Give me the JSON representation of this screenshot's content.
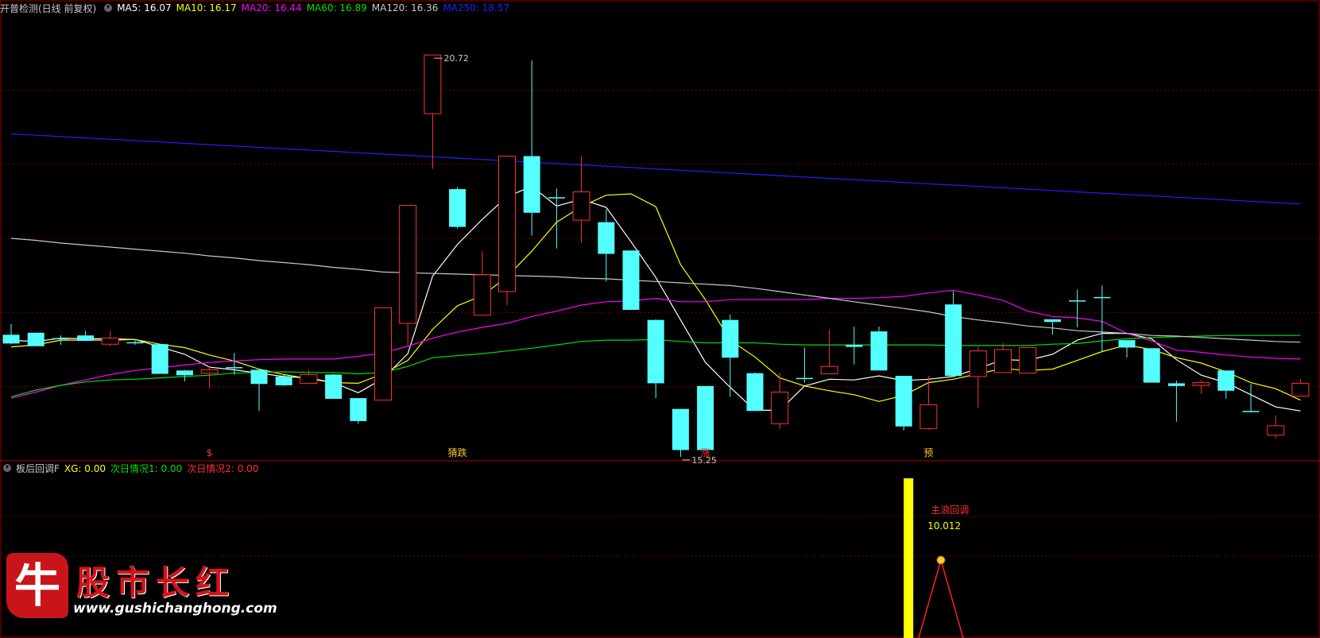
{
  "main_panel": {
    "title": "开普检测(日线 前复权)",
    "ma_labels": [
      {
        "name": "MA5",
        "value": "16.07",
        "color": "#ffffff"
      },
      {
        "name": "MA10",
        "value": "16.17",
        "color": "#ffff00"
      },
      {
        "name": "MA20",
        "value": "16.44",
        "color": "#ff00ff"
      },
      {
        "name": "MA60",
        "value": "16.89",
        "color": "#00e000"
      },
      {
        "name": "MA120",
        "value": "16.36",
        "color": "#c8c8c8"
      },
      {
        "name": "MA250",
        "value": "18.57",
        "color": "#2020ff"
      }
    ]
  },
  "sub_panel": {
    "title": "板后回调F",
    "indicators": [
      {
        "name": "XG",
        "value": "0.00",
        "color": "#ffff00"
      },
      {
        "name": "次日情况1",
        "value": "0.00",
        "color": "#00e000"
      },
      {
        "name": "次日情况2",
        "value": "0.00",
        "color": "#ff3030"
      }
    ]
  },
  "chart_data": [
    {
      "type": "candlestick",
      "ylim": [
        14.7,
        21.3
      ],
      "colors": {
        "up": "#ff3232",
        "down": "#54ffff",
        "bg": "#000000"
      },
      "candles": [
        [
          16.57,
          16.44,
          16.73,
          16.43
        ],
        [
          16.6,
          16.4,
          16.6,
          16.4
        ],
        [
          16.52,
          16.52,
          16.56,
          16.42
        ],
        [
          16.56,
          16.48,
          16.63,
          16.48
        ],
        [
          16.43,
          16.52,
          16.63,
          16.4
        ],
        [
          16.46,
          16.46,
          16.5,
          16.42
        ],
        [
          16.43,
          15.99,
          16.43,
          15.99
        ],
        [
          16.04,
          15.97,
          16.05,
          15.88
        ],
        [
          16.0,
          16.05,
          16.1,
          15.77
        ],
        [
          16.09,
          16.09,
          16.3,
          15.98
        ],
        [
          16.05,
          15.84,
          16.05,
          15.44
        ],
        [
          15.95,
          15.82,
          15.98,
          15.81
        ],
        [
          15.85,
          15.98,
          16.05,
          15.85
        ],
        [
          15.98,
          15.62,
          15.99,
          15.62
        ],
        [
          15.63,
          15.29,
          15.63,
          15.25
        ],
        [
          15.6,
          16.97,
          16.97,
          15.6
        ],
        [
          16.74,
          18.49,
          18.49,
          16.41
        ],
        [
          19.85,
          20.72,
          20.72,
          19.03
        ],
        [
          18.73,
          18.17,
          18.76,
          18.15
        ],
        [
          16.86,
          17.46,
          17.81,
          16.86
        ],
        [
          17.21,
          19.22,
          19.22,
          17.01
        ],
        [
          19.22,
          18.38,
          20.64,
          18.04
        ],
        [
          18.61,
          18.61,
          18.74,
          17.85
        ],
        [
          18.27,
          18.69,
          19.22,
          17.93
        ],
        [
          18.24,
          17.77,
          18.43,
          17.36
        ],
        [
          17.82,
          16.94,
          17.82,
          16.94
        ],
        [
          16.79,
          15.85,
          16.8,
          15.63
        ],
        [
          15.47,
          14.86,
          15.47,
          14.76
        ],
        [
          15.81,
          14.86,
          15.81,
          14.86
        ],
        [
          16.79,
          16.23,
          16.87,
          15.65
        ],
        [
          16.0,
          15.44,
          16.01,
          15.44
        ],
        [
          15.25,
          15.72,
          16.01,
          15.17
        ],
        [
          15.93,
          15.93,
          16.38,
          15.86
        ],
        [
          15.99,
          16.1,
          16.65,
          15.99
        ],
        [
          16.42,
          16.39,
          16.69,
          16.13
        ],
        [
          16.62,
          16.04,
          16.69,
          16.04
        ],
        [
          15.96,
          15.21,
          15.96,
          15.15
        ],
        [
          15.18,
          15.53,
          15.96,
          15.16
        ],
        [
          17.02,
          15.96,
          17.22,
          15.96
        ],
        [
          15.95,
          16.33,
          16.39,
          15.49
        ],
        [
          16.01,
          16.35,
          16.45,
          16.01
        ],
        [
          16.0,
          16.38,
          16.38,
          16.0
        ],
        [
          16.8,
          16.76,
          16.8,
          16.57
        ],
        [
          17.08,
          17.08,
          17.24,
          16.68
        ],
        [
          17.13,
          17.13,
          17.3,
          16.32
        ],
        [
          16.49,
          16.38,
          16.49,
          16.23
        ],
        [
          16.37,
          15.86,
          16.37,
          15.86
        ],
        [
          15.85,
          15.81,
          15.89,
          15.28
        ],
        [
          15.82,
          15.86,
          15.9,
          15.69
        ],
        [
          16.04,
          15.74,
          16.04,
          15.62
        ],
        [
          15.44,
          15.44,
          15.84,
          15.44
        ],
        [
          15.08,
          15.22,
          15.37,
          15.03
        ],
        [
          15.66,
          15.85,
          15.91,
          15.68
        ]
      ]
    },
    {
      "type": "line",
      "series": [
        {
          "name": "MA5",
          "color": "#ffffff",
          "values": [
            16.49,
            16.47,
            16.52,
            16.51,
            16.51,
            16.5,
            16.39,
            16.28,
            16.09,
            16.05,
            16.0,
            15.95,
            15.93,
            15.86,
            15.71,
            15.92,
            16.29,
            17.44,
            17.91,
            18.28,
            18.62,
            18.77,
            18.48,
            18.58,
            18.46,
            17.95,
            17.42,
            16.79,
            16.16,
            15.79,
            15.45,
            15.45,
            15.81,
            15.91,
            15.9,
            15.96,
            15.89,
            15.91,
            15.95,
            16.07,
            16.2,
            16.19,
            16.28,
            16.49,
            16.59,
            16.59,
            16.51,
            16.2,
            15.97,
            15.86,
            15.68,
            15.5,
            15.44
          ]
        },
        {
          "name": "MA10",
          "color": "#ffff00",
          "values": [
            16.39,
            16.42,
            16.49,
            16.49,
            16.49,
            16.5,
            16.43,
            16.38,
            16.27,
            16.18,
            16.06,
            15.98,
            15.92,
            15.86,
            15.85,
            15.99,
            16.19,
            16.65,
            17.0,
            17.15,
            17.43,
            17.81,
            18.24,
            18.47,
            18.64,
            18.66,
            18.47,
            17.61,
            17.09,
            16.49,
            16.24,
            15.93,
            15.81,
            15.74,
            15.68,
            15.58,
            15.67,
            15.86,
            15.91,
            15.99,
            16.07,
            16.04,
            16.06,
            16.19,
            16.32,
            16.42,
            16.35,
            16.23,
            16.15,
            16.02,
            15.86,
            15.77,
            15.6
          ]
        },
        {
          "name": "MA20",
          "color": "#ff00ff",
          "values": [
            15.63,
            15.72,
            15.82,
            15.9,
            15.98,
            16.04,
            16.08,
            16.12,
            16.16,
            16.18,
            16.2,
            16.21,
            16.21,
            16.21,
            16.25,
            16.3,
            16.4,
            16.52,
            16.61,
            16.68,
            16.74,
            16.84,
            16.92,
            17.01,
            17.06,
            17.07,
            17.11,
            17.06,
            17.06,
            17.09,
            17.09,
            17.09,
            17.09,
            17.11,
            17.11,
            17.12,
            17.14,
            17.19,
            17.23,
            17.16,
            17.08,
            16.92,
            16.84,
            16.82,
            16.77,
            16.59,
            16.48,
            16.34,
            16.31,
            16.27,
            16.24,
            16.22,
            16.21
          ]
        },
        {
          "name": "MA60",
          "color": "#00e000",
          "values": [
            15.65,
            15.75,
            15.82,
            15.87,
            15.9,
            15.91,
            15.93,
            15.95,
            15.97,
            16.0,
            16.01,
            16.02,
            16.01,
            16.01,
            15.99,
            16.01,
            16.1,
            16.23,
            16.26,
            16.29,
            16.33,
            16.37,
            16.42,
            16.47,
            16.49,
            16.49,
            16.5,
            16.47,
            16.45,
            16.45,
            16.45,
            16.43,
            16.42,
            16.42,
            16.42,
            16.42,
            16.42,
            16.42,
            16.41,
            16.41,
            16.41,
            16.41,
            16.43,
            16.44,
            16.48,
            16.51,
            16.53,
            16.54,
            16.55,
            16.56,
            16.56,
            16.56,
            16.56
          ]
        },
        {
          "name": "MA120",
          "color": "#c8c8c8",
          "values": [
            18.0,
            17.97,
            17.93,
            17.9,
            17.87,
            17.84,
            17.81,
            17.78,
            17.74,
            17.71,
            17.67,
            17.64,
            17.61,
            17.57,
            17.54,
            17.5,
            17.49,
            17.48,
            17.47,
            17.46,
            17.45,
            17.44,
            17.43,
            17.41,
            17.4,
            17.38,
            17.36,
            17.34,
            17.32,
            17.3,
            17.26,
            17.21,
            17.16,
            17.11,
            17.06,
            17.01,
            16.96,
            16.91,
            16.84,
            16.79,
            16.75,
            16.7,
            16.67,
            16.63,
            16.61,
            16.59,
            16.56,
            16.55,
            16.53,
            16.51,
            16.49,
            16.47,
            16.46
          ]
        },
        {
          "name": "MA250",
          "color": "#2020ff",
          "values": [
            19.55,
            19.53,
            19.51,
            19.49,
            19.47,
            19.45,
            19.43,
            19.41,
            19.39,
            19.37,
            19.35,
            19.33,
            19.31,
            19.29,
            19.27,
            19.25,
            19.23,
            19.21,
            19.19,
            19.17,
            19.15,
            19.13,
            19.11,
            19.09,
            19.07,
            19.05,
            19.03,
            19.01,
            18.99,
            18.97,
            18.95,
            18.93,
            18.91,
            18.89,
            18.87,
            18.85,
            18.83,
            18.81,
            18.79,
            18.77,
            18.75,
            18.73,
            18.71,
            18.69,
            18.67,
            18.65,
            18.63,
            18.61,
            18.59,
            18.57,
            18.55,
            18.53,
            18.51
          ]
        }
      ]
    }
  ],
  "annotations": {
    "high_label": "20.72",
    "low_label": "15.25",
    "markers": [
      {
        "candle": 8,
        "text": "$",
        "color": "#ff3030"
      },
      {
        "candle": 18,
        "text": "猜跌",
        "color": "#ffc830"
      },
      {
        "candle": 28,
        "text": "涨",
        "color": "#ff3030"
      },
      {
        "candle": 37,
        "text": "预",
        "color": "#ffc830"
      }
    ],
    "sub_text": "主浪回调",
    "sub_value": "10.012",
    "sub_bar_color": "#ffff00",
    "sub_line_color": "#ff2020"
  },
  "logo": {
    "mark": "牛",
    "title": "股市长红",
    "url": "www.gushichanghong.com"
  }
}
